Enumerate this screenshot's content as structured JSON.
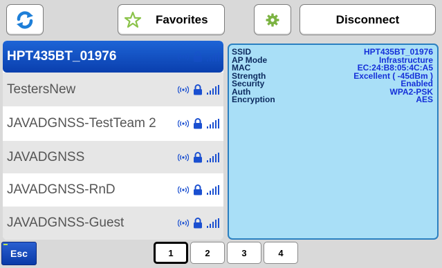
{
  "toolbar": {
    "refresh_icon": "refresh-icon",
    "favorites_label": "Favorites",
    "favorites_icon": "star-icon",
    "settings_icon": "gear-icon",
    "disconnect_label": "Disconnect"
  },
  "networks": [
    {
      "name": "HPT435BT_01976",
      "selected": true
    },
    {
      "name": "TestersNew",
      "selected": false
    },
    {
      "name": "JAVADGNSS-TestTeam 2",
      "selected": false
    },
    {
      "name": "JAVADGNSS",
      "selected": false
    },
    {
      "name": "JAVADGNSS-RnD",
      "selected": false
    },
    {
      "name": "JAVADGNSS-Guest",
      "selected": false
    }
  ],
  "network_icons": [
    "wifi-broadcast-icon",
    "lock-icon",
    "signal-bars-icon"
  ],
  "details": {
    "ssid_label": "SSID",
    "ssid": "HPT435BT_01976",
    "ap_mode_label": "AP Mode",
    "ap_mode": "Infrastructure",
    "mac_label": "MAC",
    "mac": "EC:24:B8:05:4C:A5",
    "strength_label": "Strength",
    "strength": "Excellent ( -45dBm )",
    "security_label": "Security",
    "security": "Enabled",
    "auth_label": "Auth",
    "auth": "WPA2-PSK",
    "encryption_label": "Encryption",
    "encryption": "AES"
  },
  "footer": {
    "esc_label": "Esc",
    "pages": [
      "1",
      "2",
      "3",
      "4"
    ],
    "active_page": "1"
  },
  "colors": {
    "selected_row": "#1d64d6",
    "details_bg": "#a9dff7",
    "detail_value": "#1530d8",
    "icon_blue": "#1a4fd0",
    "star_green": "#8bc34a",
    "gear_green": "#7cb342"
  }
}
